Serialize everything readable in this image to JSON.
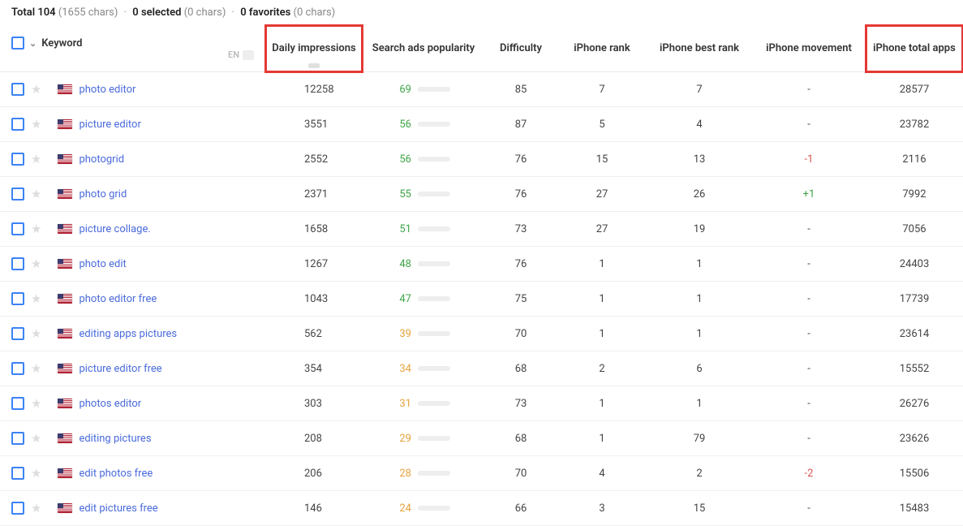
{
  "summary": {
    "totalLabel": "Total",
    "totalCount": "104",
    "totalChars": "(1655 chars)",
    "selectedLabel": "0 selected",
    "selectedChars": "(0 chars)",
    "favoritesLabel": "0 favorites",
    "favoritesChars": "(0 chars)"
  },
  "lang": {
    "code": "EN"
  },
  "headers": {
    "keyword": "Keyword",
    "dailyImpressions": "Daily impressions",
    "searchAds": "Search ads popularity",
    "difficulty": "Difficulty",
    "iphoneRank": "iPhone rank",
    "iphoneBest": "iPhone best rank",
    "iphoneMovement": "iPhone movement",
    "iphoneTotal": "iPhone total apps"
  },
  "rows": [
    {
      "keyword": "photo editor",
      "di": "12258",
      "sap": 69,
      "sapClass": "green",
      "diff": "85",
      "rank": "7",
      "best": "7",
      "mv": "-",
      "mvClass": "",
      "total": "28577"
    },
    {
      "keyword": "picture editor",
      "di": "3551",
      "sap": 56,
      "sapClass": "green",
      "diff": "87",
      "rank": "5",
      "best": "4",
      "mv": "-",
      "mvClass": "",
      "total": "23782"
    },
    {
      "keyword": "photogrid",
      "di": "2552",
      "sap": 56,
      "sapClass": "green",
      "diff": "76",
      "rank": "15",
      "best": "13",
      "mv": "-1",
      "mvClass": "mv-neg",
      "total": "2116"
    },
    {
      "keyword": "photo grid",
      "di": "2371",
      "sap": 55,
      "sapClass": "green",
      "diff": "76",
      "rank": "27",
      "best": "26",
      "mv": "+1",
      "mvClass": "mv-pos",
      "total": "7992"
    },
    {
      "keyword": "picture collage.",
      "di": "1658",
      "sap": 51,
      "sapClass": "green",
      "diff": "73",
      "rank": "27",
      "best": "19",
      "mv": "-",
      "mvClass": "",
      "total": "7056"
    },
    {
      "keyword": "photo edit",
      "di": "1267",
      "sap": 48,
      "sapClass": "green",
      "diff": "76",
      "rank": "1",
      "best": "1",
      "mv": "-",
      "mvClass": "",
      "total": "24403"
    },
    {
      "keyword": "photo editor free",
      "di": "1043",
      "sap": 47,
      "sapClass": "green",
      "diff": "75",
      "rank": "1",
      "best": "1",
      "mv": "-",
      "mvClass": "",
      "total": "17739"
    },
    {
      "keyword": "editing apps pictures",
      "di": "562",
      "sap": 39,
      "sapClass": "orange",
      "diff": "70",
      "rank": "1",
      "best": "1",
      "mv": "-",
      "mvClass": "",
      "total": "23614"
    },
    {
      "keyword": "picture editor free",
      "di": "354",
      "sap": 34,
      "sapClass": "orange",
      "diff": "68",
      "rank": "2",
      "best": "6",
      "mv": "-",
      "mvClass": "",
      "total": "15552"
    },
    {
      "keyword": "photos editor",
      "di": "303",
      "sap": 31,
      "sapClass": "orange",
      "diff": "73",
      "rank": "1",
      "best": "1",
      "mv": "-",
      "mvClass": "",
      "total": "26276"
    },
    {
      "keyword": "editing pictures",
      "di": "208",
      "sap": 29,
      "sapClass": "orange",
      "diff": "68",
      "rank": "1",
      "best": "79",
      "mv": "-",
      "mvClass": "",
      "total": "23626"
    },
    {
      "keyword": "edit photos free",
      "di": "206",
      "sap": 28,
      "sapClass": "orange",
      "diff": "70",
      "rank": "4",
      "best": "2",
      "mv": "-2",
      "mvClass": "mv-neg",
      "total": "15506"
    },
    {
      "keyword": "edit pictures free",
      "di": "146",
      "sap": 24,
      "sapClass": "orange",
      "diff": "66",
      "rank": "3",
      "best": "15",
      "mv": "-",
      "mvClass": "",
      "total": "15483"
    }
  ]
}
